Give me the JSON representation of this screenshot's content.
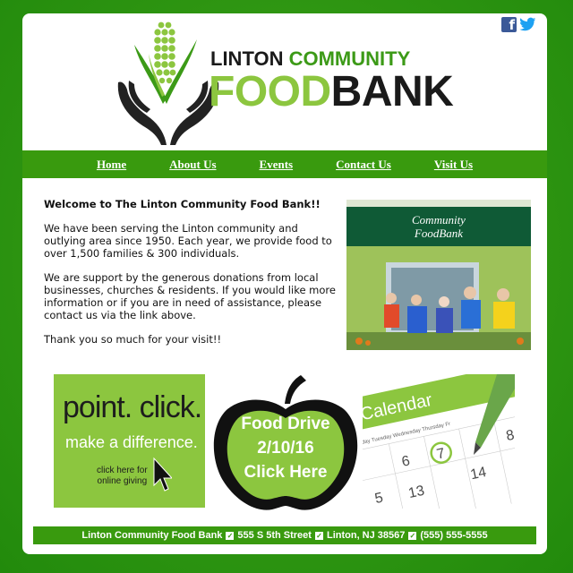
{
  "header": {
    "logo_line1_a": "LINTON",
    "logo_line1_b": "COMMUNITY",
    "logo_line2_a": "FOOD",
    "logo_line2_b": "BANK",
    "social": [
      "facebook-icon",
      "twitter-icon"
    ]
  },
  "nav": {
    "items": [
      {
        "label": "Home"
      },
      {
        "label": "About Us"
      },
      {
        "label": "Events"
      },
      {
        "label": "Contact Us"
      },
      {
        "label": "Visit Us"
      }
    ]
  },
  "main": {
    "welcome": "Welcome to The Linton Community Food Bank!!",
    "para1": "We have been serving the Linton community and outlying area since 1950. Each year, we provide food to over 1,500 families & 300 individuals.",
    "para2": "We are support by the generous donations from local businesses, churches & residents. If you would like more information or if you are in need of assistance, please contact us via the link above.",
    "para3": "Thank you so much for your visit!!",
    "photo_sign_line1": "Community",
    "photo_sign_line2": "FoodBank"
  },
  "promos": {
    "giving_line1": "point. click.",
    "giving_line2": "make a difference.",
    "giving_line3": "click here for",
    "giving_line4": "online giving",
    "drive_line1": "Food Drive",
    "drive_line2": "2/10/16",
    "drive_line3": "Click Here",
    "calendar_title": "Calendar",
    "calendar_days": "unday   Tuesday  Wednesday  Thursday   Fr",
    "calendar_numbers": [
      "5",
      "6",
      "7",
      "8",
      "13",
      "14"
    ]
  },
  "footer": {
    "name": "Linton Community Food Bank",
    "street": "555 S 5th Street",
    "city": "Linton, NJ 38567",
    "phone": "(555) 555-5555"
  },
  "colors": {
    "brand_green": "#399a0e",
    "light_green": "#8cc63f",
    "background": "#2f9612"
  }
}
